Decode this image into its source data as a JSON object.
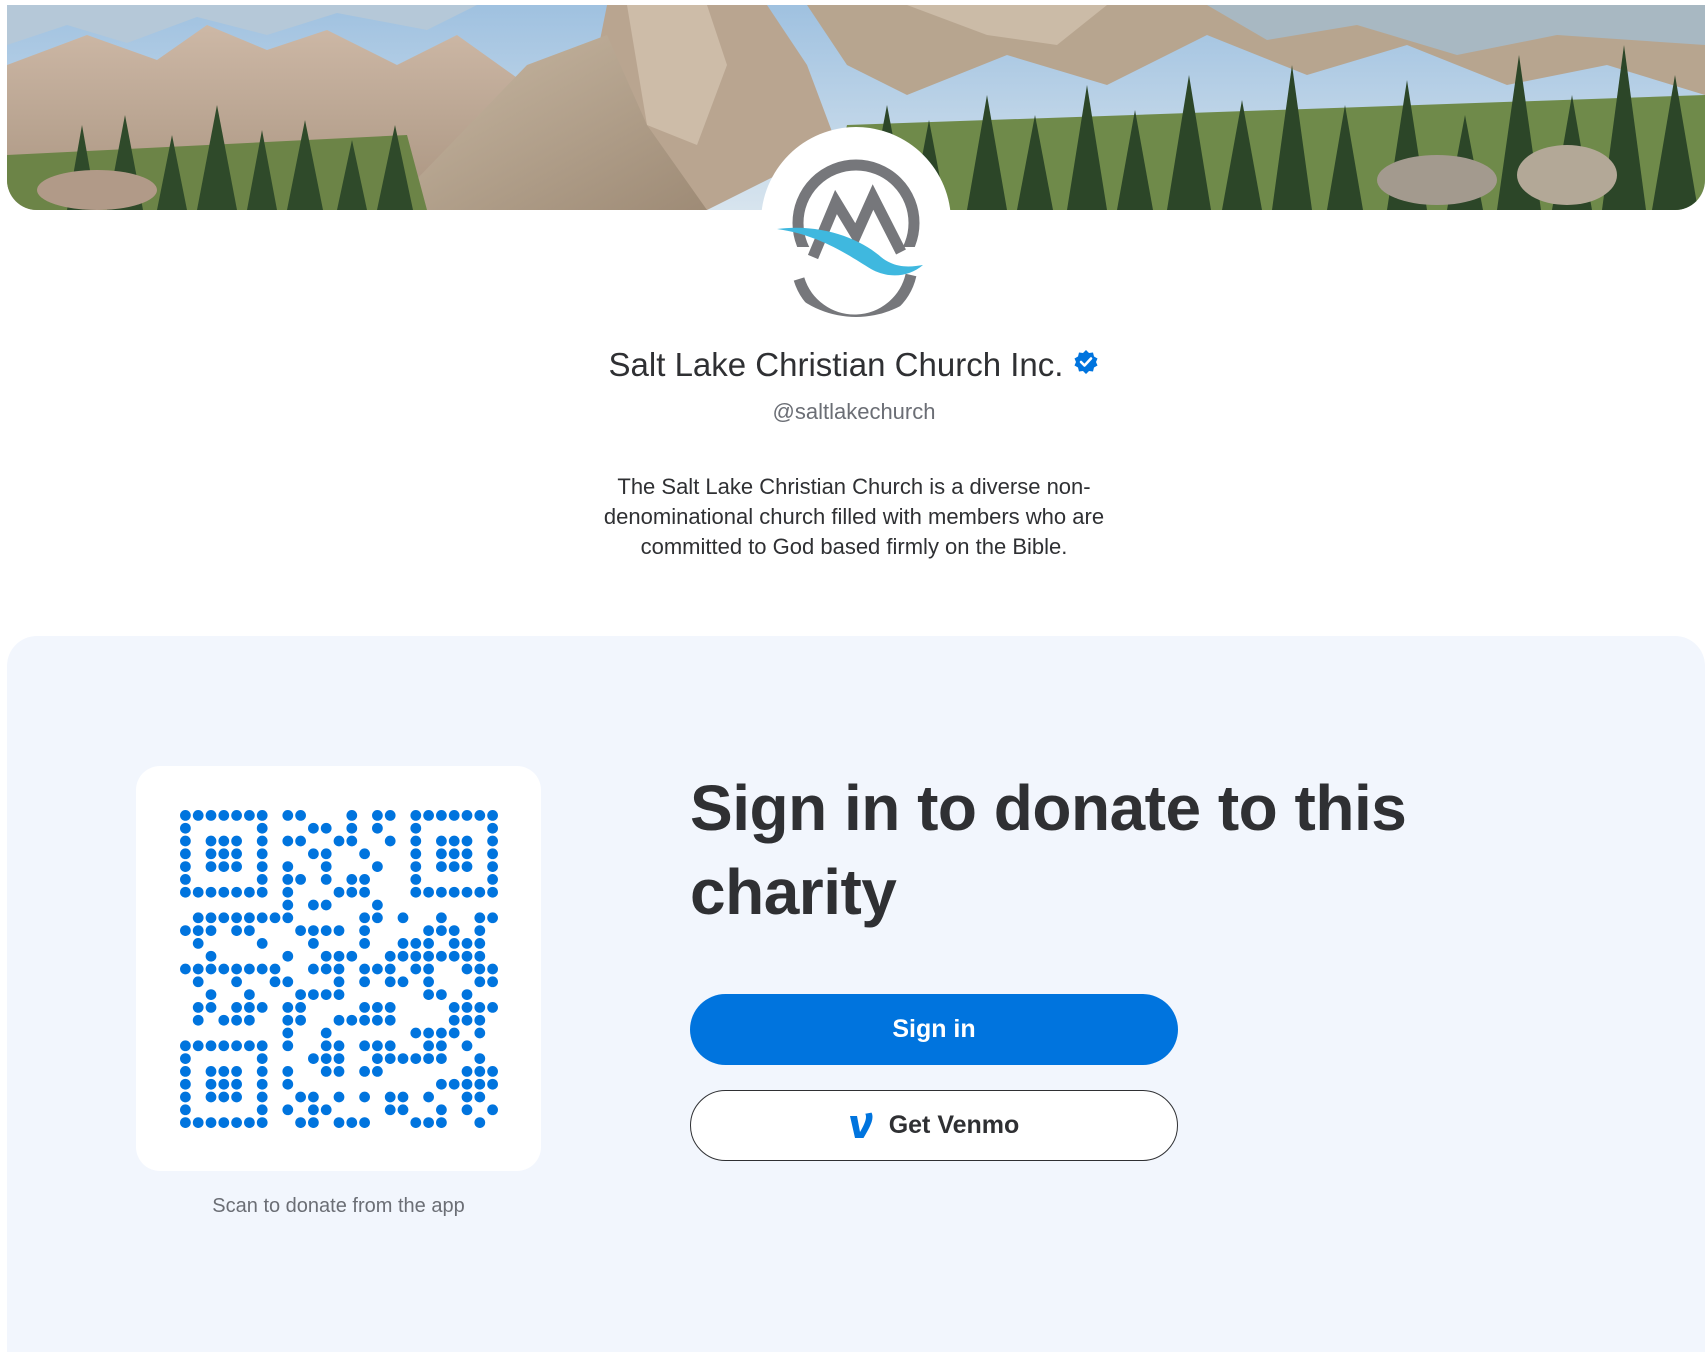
{
  "profile": {
    "name": "Salt Lake Christian Church Inc.",
    "handle": "@saltlakechurch",
    "verified": true,
    "description": "The Salt Lake Christian Church is a diverse non-denominational church filled with members who are committed to God based firmly on the Bible."
  },
  "banner": {
    "scene": "mountain landscape with pine trees and rocky cliffs"
  },
  "avatar": {
    "icon": "mountain-logo-icon"
  },
  "donate": {
    "heading": "Sign in to donate to this charity",
    "qr_caption": "Scan to donate from the app",
    "signin_label": "Sign in",
    "venmo_label": "Get Venmo"
  },
  "colors": {
    "accent": "#0074de",
    "panel_bg": "#f2f6fd",
    "qr_dot": "#0074de",
    "text": "#2f3033",
    "muted": "#6b6e75",
    "logo_gray": "#76777b",
    "logo_wave": "#3fb8df"
  }
}
